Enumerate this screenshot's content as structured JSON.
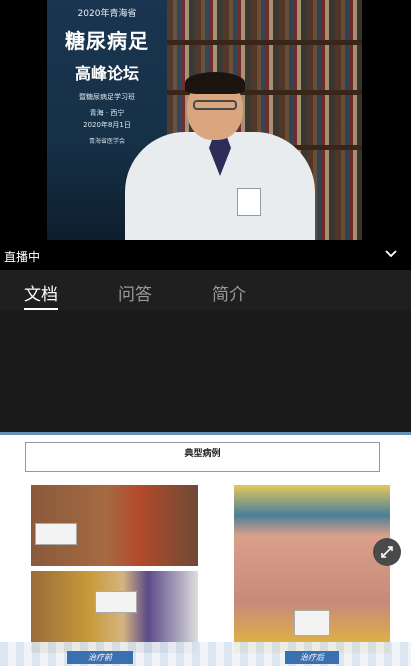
{
  "video": {
    "poster": {
      "year_line": "2020年青海省",
      "title_line1": "糖尿病足",
      "title_line2": "高峰论坛",
      "subtitle": "暨糖尿病足学习班",
      "location": "青海 · 西宁",
      "date": "2020年8月1日",
      "organizer": "青海省医学会"
    }
  },
  "status": {
    "live_label": "直播中"
  },
  "tabs": [
    {
      "label": "文档",
      "active": true
    },
    {
      "label": "问答",
      "active": false
    },
    {
      "label": "简介",
      "active": false
    }
  ],
  "slide": {
    "title": "典型病例",
    "before_label": "治疗前",
    "after_label": "治疗后"
  }
}
